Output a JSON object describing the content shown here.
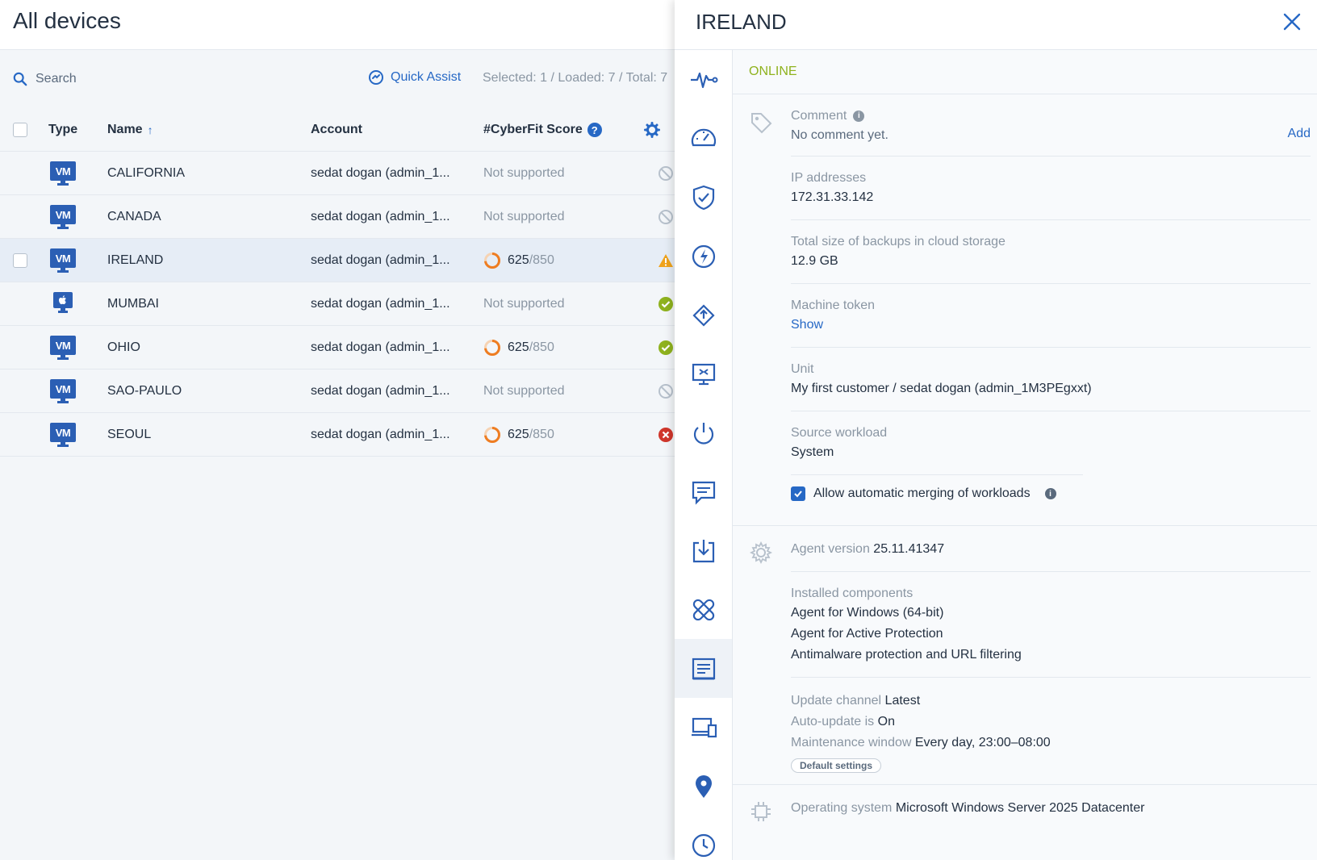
{
  "header": {
    "title": "All devices"
  },
  "toolbar": {
    "search_placeholder": "Search",
    "quick_assist_label": "Quick Assist",
    "counts": "Selected: 1 / Loaded: 7 / Total: 7"
  },
  "table": {
    "columns": {
      "type": "Type",
      "name": "Name",
      "account": "Account",
      "score": "#CyberFit Score"
    },
    "rows": [
      {
        "type_icon": "vm-icon",
        "type_text": "VM",
        "name": "CALIFORNIA",
        "account": "sedat dogan (admin_1...",
        "score_text": "Not supported",
        "status": "disabled"
      },
      {
        "type_icon": "vm-icon",
        "type_text": "VM",
        "name": "CANADA",
        "account": "sedat dogan (admin_1...",
        "score_text": "Not supported",
        "status": "disabled"
      },
      {
        "type_icon": "vm-icon",
        "type_text": "VM",
        "name": "IRELAND",
        "account": "sedat dogan (admin_1...",
        "score_value": "625",
        "score_max": "/850",
        "status": "warning"
      },
      {
        "type_icon": "apple-icon",
        "type_text": "",
        "name": "MUMBAI",
        "account": "sedat dogan (admin_1...",
        "score_text": "Not supported",
        "status": "ok"
      },
      {
        "type_icon": "vm-icon",
        "type_text": "VM",
        "name": "OHIO",
        "account": "sedat dogan (admin_1...",
        "score_value": "625",
        "score_max": "/850",
        "status": "ok"
      },
      {
        "type_icon": "vm-icon",
        "type_text": "VM",
        "name": "SAO-PAULO",
        "account": "sedat dogan (admin_1...",
        "score_text": "Not supported",
        "status": "disabled"
      },
      {
        "type_icon": "vm-icon",
        "type_text": "VM",
        "name": "SEOUL",
        "account": "sedat dogan (admin_1...",
        "score_value": "625",
        "score_max": "/850",
        "status": "error"
      }
    ]
  },
  "detail": {
    "title": "IRELAND",
    "status": "ONLINE",
    "comment": {
      "label": "Comment",
      "value": "No comment yet.",
      "add_label": "Add"
    },
    "ip": {
      "label": "IP addresses",
      "value": "172.31.33.142"
    },
    "backup_size": {
      "label": "Total size of backups in cloud storage",
      "value": "12.9 GB"
    },
    "token": {
      "label": "Machine token",
      "link": "Show"
    },
    "unit": {
      "label": "Unit",
      "value": "My first customer / sedat dogan (admin_1M3PEgxxt)"
    },
    "source": {
      "label": "Source workload",
      "value": "System"
    },
    "merge": {
      "label": "Allow automatic merging of workloads",
      "checked": true
    },
    "agent": {
      "version_label": "Agent version",
      "version_value": "25.11.41347",
      "components_label": "Installed components",
      "components": [
        "Agent for Windows (64-bit)",
        "Agent for Active Protection",
        "Antimalware protection and URL filtering"
      ],
      "channel_label": "Update channel",
      "channel_value": "Latest",
      "autoupdate_label": "Auto-update is",
      "autoupdate_value": "On",
      "maintenance_label": "Maintenance window",
      "maintenance_value": "Every day, 23:00–08:00",
      "default_settings": "Default settings"
    },
    "os": {
      "label": "Operating system",
      "value": "Microsoft Windows Server 2025 Datacenter"
    }
  },
  "rail": [
    "activity-icon",
    "dashboard-icon",
    "protection-shield-icon",
    "lightning-icon",
    "patch-icon",
    "remote-desktop-icon",
    "power-icon",
    "chat-icon",
    "download-icon",
    "bandage-icon",
    "details-icon",
    "devices-icon",
    "location-pin-icon",
    "clock-icon"
  ],
  "colors": {
    "accent": "#2668c5",
    "online": "#8fb21e",
    "warning": "#f0a31c",
    "ok": "#8fb21e",
    "error": "#d0362b",
    "score_ring": "#ee7d22"
  }
}
